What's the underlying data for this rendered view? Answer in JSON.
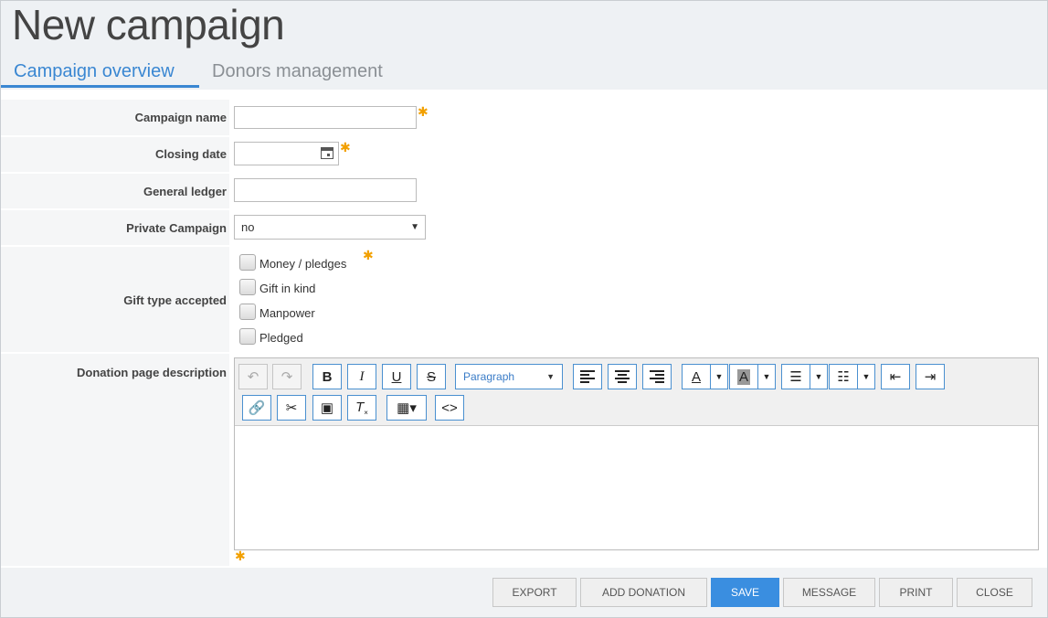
{
  "header": {
    "title": "New campaign",
    "tabs": [
      {
        "label": "Campaign overview",
        "active": true
      },
      {
        "label": "Donors management",
        "active": false
      }
    ]
  },
  "form": {
    "campaign_name": {
      "label": "Campaign name",
      "value": "",
      "required": true
    },
    "closing_date": {
      "label": "Closing date",
      "value": "",
      "required": true
    },
    "general_ledger": {
      "label": "General ledger",
      "value": ""
    },
    "private_campaign": {
      "label": "Private Campaign",
      "value": "no"
    },
    "gift_type": {
      "label": "Gift type accepted",
      "required": true,
      "options": [
        {
          "label": "Money / pledges",
          "checked": false
        },
        {
          "label": "Gift in kind",
          "checked": false
        },
        {
          "label": "Manpower",
          "checked": false
        },
        {
          "label": "Pledged",
          "checked": false
        }
      ]
    },
    "donation_description": {
      "label": "Donation page description",
      "required": true,
      "format_block": "Paragraph",
      "content": ""
    }
  },
  "footer": {
    "buttons": [
      "EXPORT",
      "ADD DONATION",
      "SAVE",
      "MESSAGE",
      "PRINT",
      "CLOSE"
    ]
  },
  "colors": {
    "accent": "#3a87d2",
    "required_star": "#f2a000",
    "primary_button": "#3a8ee0"
  }
}
